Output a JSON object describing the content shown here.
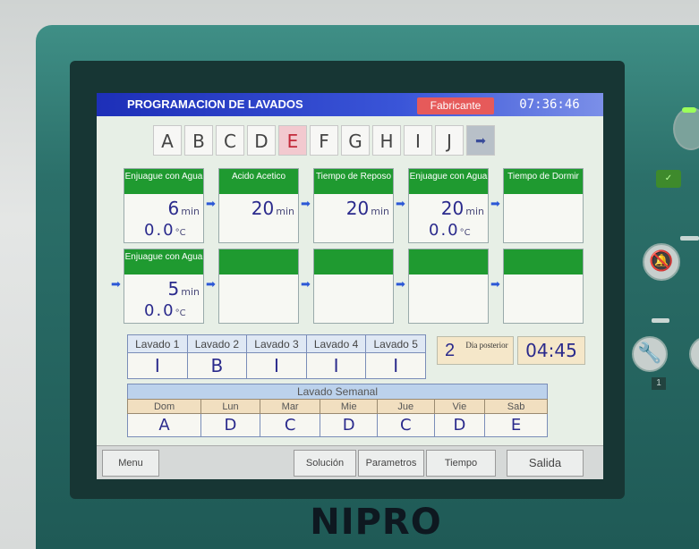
{
  "device": {
    "brand": "NIPRO"
  },
  "screen": {
    "title": "PROGRAMACION DE LAVADOS",
    "mode_badge": "Fabricante",
    "clock": "07:36:46"
  },
  "program_tabs": [
    "A",
    "B",
    "C",
    "D",
    "E",
    "F",
    "G",
    "H",
    "I",
    "J"
  ],
  "program_next": "➡",
  "active_tab": "E",
  "row1": [
    {
      "head": "Enjuague con Agua",
      "time": "6",
      "unit": "min",
      "temp": "0.0",
      "temp_unit": "°C"
    },
    {
      "head": "Acido Acetico",
      "time": "20",
      "unit": "min",
      "temp": "",
      "temp_unit": ""
    },
    {
      "head": "Tiempo de Reposo",
      "time": "20",
      "unit": "min",
      "temp": "",
      "temp_unit": ""
    },
    {
      "head": "Enjuague con Agua",
      "time": "20",
      "unit": "min",
      "temp": "0.0",
      "temp_unit": "°C"
    },
    {
      "head": "Tiempo de Dormir",
      "time": "",
      "unit": "",
      "temp": "",
      "temp_unit": ""
    }
  ],
  "row2": [
    {
      "head": "Enjuague con Agua",
      "time": "5",
      "unit": "min",
      "temp": "0.0",
      "temp_unit": "°C"
    },
    {
      "head": "",
      "time": "",
      "unit": "",
      "temp": "",
      "temp_unit": ""
    },
    {
      "head": "",
      "time": "",
      "unit": "",
      "temp": "",
      "temp_unit": ""
    },
    {
      "head": "",
      "time": "",
      "unit": "",
      "temp": "",
      "temp_unit": ""
    },
    {
      "head": "",
      "time": "",
      "unit": "",
      "temp": "",
      "temp_unit": ""
    }
  ],
  "lavados": {
    "headers": [
      "Lavado 1",
      "Lavado 2",
      "Lavado 3",
      "Lavado 4",
      "Lavado 5"
    ],
    "values": [
      "I",
      "B",
      "I",
      "I",
      "I"
    ]
  },
  "dia": {
    "number": "2",
    "label": "Dia posterior",
    "time": "04:45"
  },
  "semanal": {
    "title": "Lavado Semanal",
    "days": [
      "Dom",
      "Lun",
      "Mar",
      "Mie",
      "Jue",
      "Vie",
      "Sab"
    ],
    "values": [
      "A",
      "D",
      "C",
      "D",
      "C",
      "D",
      "E"
    ]
  },
  "bottom_buttons": {
    "menu": "Menu",
    "solucion": "Solución",
    "parametros": "Parametros",
    "tiempo": "Tiempo",
    "salida": "Salida"
  },
  "panel": {
    "led_label": "✓",
    "small_number": "1"
  },
  "colors": {
    "titlebar": "#1d2fb8",
    "step_header": "#1f9a30",
    "badge": "#e65a5a",
    "active_tab": "#f2c9cf",
    "value_text": "#2a2a8c"
  }
}
